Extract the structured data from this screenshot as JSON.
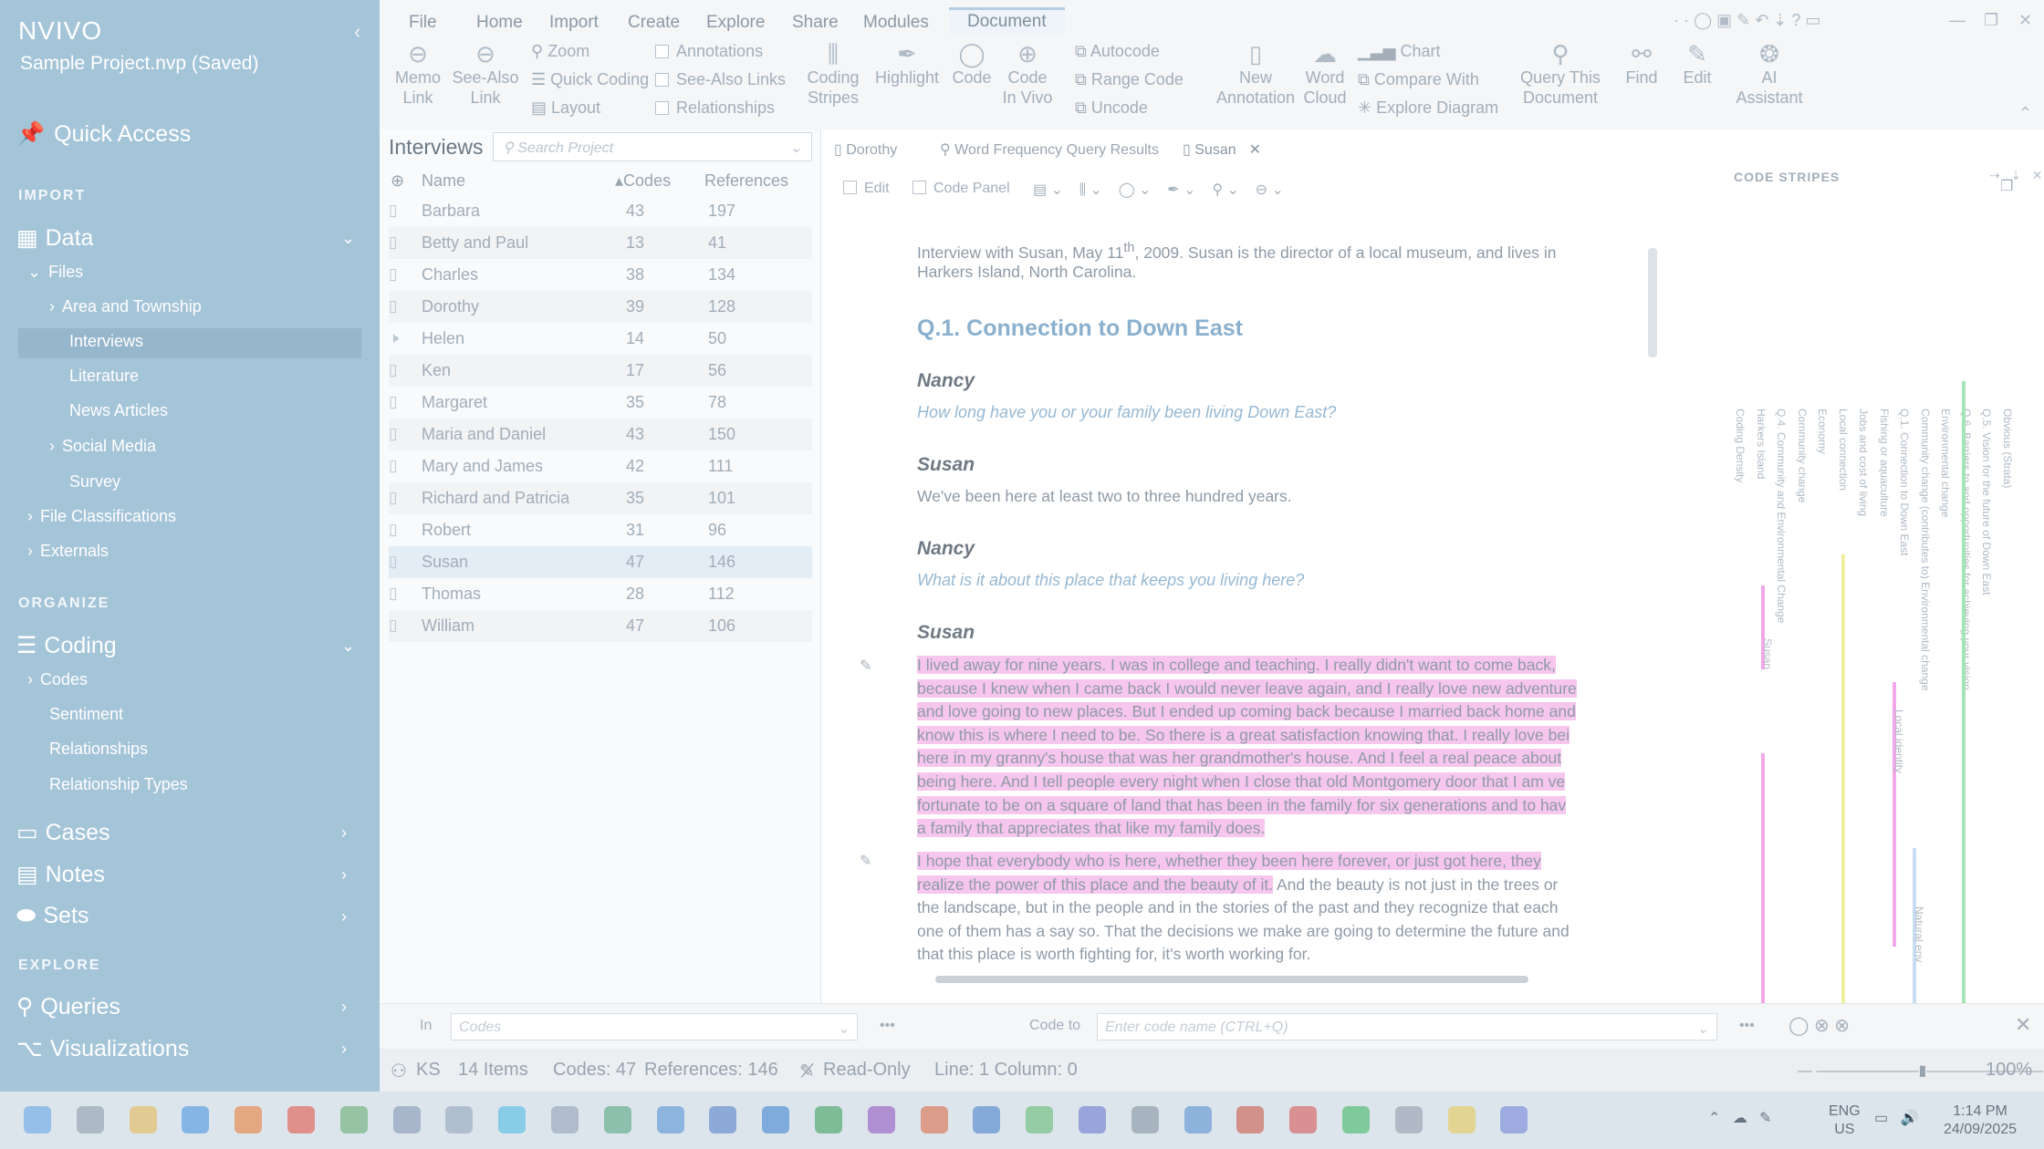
{
  "sidebar": {
    "logo": "NVIVO",
    "project": "Sample Project.nvp (Saved)",
    "quick_access": "Quick Access",
    "sections": {
      "import": "IMPORT",
      "organize": "ORGANIZE",
      "explore": "EXPLORE"
    },
    "data": "Data",
    "files": "Files",
    "file_items": [
      "Area and Township",
      "Interviews",
      "Literature",
      "News Articles",
      "Social Media",
      "Survey"
    ],
    "file_classifications": "File Classifications",
    "externals": "Externals",
    "coding": "Coding",
    "coding_items": [
      "Codes",
      "Sentiment",
      "Relationships",
      "Relationship Types"
    ],
    "cases": "Cases",
    "notes": "Notes",
    "sets": "Sets",
    "queries": "Queries",
    "visualizations": "Visualizations"
  },
  "ribbon": {
    "tabs": [
      "File",
      "Home",
      "Import",
      "Create",
      "Explore",
      "Share",
      "Modules",
      "Document"
    ],
    "memo_link": [
      "Memo",
      "Link"
    ],
    "see_also_link": [
      "See-Also",
      "Link"
    ],
    "zoom": "Zoom",
    "quick_coding": "Quick Coding",
    "layout": "Layout",
    "annotations": "Annotations",
    "see_also_links": "See-Also Links",
    "relationships": "Relationships",
    "coding_stripes": [
      "Coding",
      "Stripes"
    ],
    "highlight": "Highlight",
    "code": "Code",
    "code_in_vivo": [
      "Code",
      "In Vivo"
    ],
    "autocode": "Autocode",
    "range_code": "Range Code",
    "uncode": "Uncode",
    "new_annotation": [
      "New",
      "Annotation"
    ],
    "word_cloud": [
      "Word",
      "Cloud"
    ],
    "chart": "Chart",
    "compare_with": "Compare With",
    "explore_diagram": "Explore Diagram",
    "query_this_document": [
      "Query This",
      "Document"
    ],
    "find": "Find",
    "edit": "Edit",
    "ai_assistant": [
      "AI",
      "Assistant"
    ]
  },
  "list": {
    "title": "Interviews",
    "search_placeholder": "Search Project",
    "columns": {
      "name": "Name",
      "codes": "Codes",
      "references": "References"
    },
    "rows": [
      {
        "name": "Barbara",
        "codes": "43",
        "refs": "197"
      },
      {
        "name": "Betty and Paul",
        "codes": "13",
        "refs": "41"
      },
      {
        "name": "Charles",
        "codes": "38",
        "refs": "134"
      },
      {
        "name": "Dorothy",
        "codes": "39",
        "refs": "128"
      },
      {
        "name": "Helen",
        "codes": "14",
        "refs": "50"
      },
      {
        "name": "Ken",
        "codes": "17",
        "refs": "56"
      },
      {
        "name": "Margaret",
        "codes": "35",
        "refs": "78"
      },
      {
        "name": "Maria and Daniel",
        "codes": "43",
        "refs": "150"
      },
      {
        "name": "Mary and James",
        "codes": "42",
        "refs": "111"
      },
      {
        "name": "Richard and Patricia",
        "codes": "35",
        "refs": "101"
      },
      {
        "name": "Robert",
        "codes": "31",
        "refs": "96"
      },
      {
        "name": "Susan",
        "codes": "47",
        "refs": "146"
      },
      {
        "name": "Thomas",
        "codes": "28",
        "refs": "112"
      },
      {
        "name": "William",
        "codes": "47",
        "refs": "106"
      }
    ]
  },
  "doc": {
    "tabs": [
      "Dorothy",
      "Word Frequency Query Results",
      "Susan"
    ],
    "edit": "Edit",
    "code_panel": "Code Panel",
    "intro_1": "Interview with Susan, May 11",
    "intro_sup": "th",
    "intro_2": ", 2009.  Susan is the director of a local museum, and lives in",
    "intro_3": "Harkers Island, North Carolina.",
    "heading": "Q.1. Connection to Down East",
    "nancy": "Nancy",
    "susan": "Susan",
    "q1": "How long have you or your family been living Down East?",
    "a1": "We've been here at least two to three hundred years.",
    "q2": "What is it about this place that keeps you living here?",
    "p1": [
      "I lived away for nine years. I was in college and teaching. I really didn't want to come back,",
      "because I knew when I came back I would never leave again, and I really love new adventure",
      "and love going to new places. But I ended up coming back because I married back home and",
      "know this is where I need to be. So there is a great satisfaction knowing that. I really love bei",
      "here in my granny's house that was her grandmother's house. And I feel a real peace about",
      "being here. And I tell people every night when I close that old Montgomery door that I am ve",
      "fortunate to be on a square of land that has been in the family for six generations and to hav",
      "a family that appreciates that like my family does."
    ],
    "p2_hl1": "I hope that everybody who is here, whether they been here forever, or just got here, they",
    "p2_hl2": "realize the power of this place and the beauty of it.",
    "p2_rest2": " And the beauty is not just in the trees or",
    "p2": [
      "the landscape, but in the people and in the stories of the past and they recognize that each",
      "one of them has a say so. That the decisions we make are going to determine the future and",
      "that this place is worth fighting for, it's worth working for."
    ]
  },
  "stripes": {
    "title": "CODE STRIPES",
    "labels": [
      "Coding Density",
      "Harkers Island",
      "Q.4. Community and Environmental Change",
      "Community change",
      "Economy",
      "Local connection",
      "Jobs and cost of living",
      "Fishing or aquaculture",
      "Q.1. Connection to Down East",
      "Community change (contributes to) Environmental change",
      "Environmental change",
      "Q.6. Barriers to and opportunities for achieving your vision",
      "Q.5. Vision for the future of Down East",
      "Obvious (Strata)"
    ],
    "bar_labels": [
      "Susan",
      "Local identity",
      "Natural env"
    ]
  },
  "codebar": {
    "in": "In",
    "in_placeholder": "Codes",
    "code_to": "Code to",
    "code_to_placeholder": "Enter code name (CTRL+Q)"
  },
  "status": {
    "user": "KS",
    "items": "14 Items",
    "codes": "Codes: 47",
    "refs": "References: 146",
    "readonly": "Read-Only",
    "line": "Line: 1 Column: 0",
    "zoom": "100%"
  },
  "taskbar": {
    "lang1": "ENG",
    "lang2": "US",
    "time": "1:14 PM",
    "date": "24/09/2025"
  }
}
